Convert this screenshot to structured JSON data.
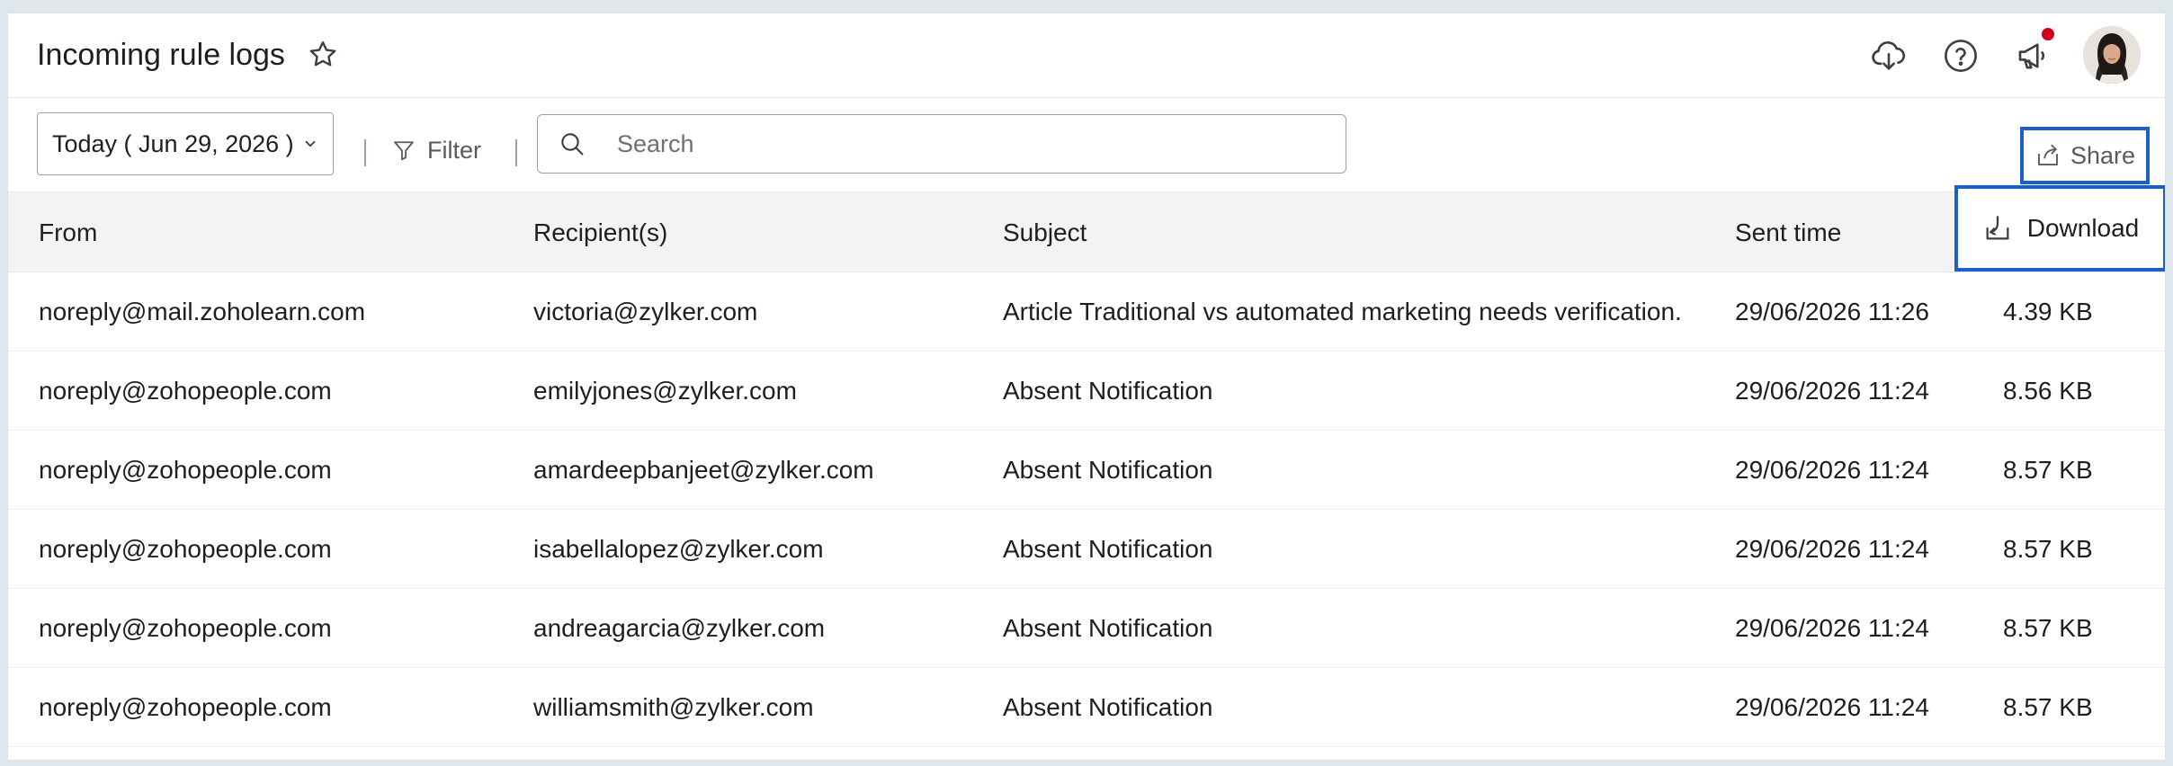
{
  "header": {
    "title": "Incoming rule logs"
  },
  "toolbar": {
    "date_label": "Today ( Jun 29, 2026 )",
    "filter_label": "Filter",
    "search_placeholder": "Search",
    "share_label": "Share"
  },
  "table": {
    "columns": {
      "from": "From",
      "recipients": "Recipient(s)",
      "subject": "Subject",
      "sent_time": "Sent time",
      "download": "Download"
    },
    "rows": [
      {
        "from": "noreply@mail.zoholearn.com",
        "recipients": "victoria@zylker.com",
        "subject": "Article Traditional vs automated marketing needs verification.",
        "sent_time": "29/06/2026 11:26",
        "size": "4.39 KB"
      },
      {
        "from": "noreply@zohopeople.com",
        "recipients": "emilyjones@zylker.com",
        "subject": "Absent Notification",
        "sent_time": "29/06/2026 11:24",
        "size": "8.56 KB"
      },
      {
        "from": "noreply@zohopeople.com",
        "recipients": "amardeepbanjeet@zylker.com",
        "subject": "Absent Notification",
        "sent_time": "29/06/2026 11:24",
        "size": "8.57 KB"
      },
      {
        "from": "noreply@zohopeople.com",
        "recipients": "isabellalopez@zylker.com",
        "subject": "Absent Notification",
        "sent_time": "29/06/2026 11:24",
        "size": "8.57 KB"
      },
      {
        "from": "noreply@zohopeople.com",
        "recipients": "andreagarcia@zylker.com",
        "subject": "Absent Notification",
        "sent_time": "29/06/2026 11:24",
        "size": "8.57 KB"
      },
      {
        "from": "noreply@zohopeople.com",
        "recipients": "williamsmith@zylker.com",
        "subject": "Absent Notification",
        "sent_time": "29/06/2026 11:24",
        "size": "8.57 KB"
      }
    ]
  },
  "icons": {
    "favorite": "star-icon",
    "download_app": "cloud-download-icon",
    "help": "help-icon",
    "announcements": "megaphone-icon",
    "filter": "filter-icon",
    "search": "search-icon",
    "share": "share-icon",
    "download": "download-icon"
  },
  "colors": {
    "highlight_border": "#1b5fc9",
    "notification_dot": "#d0021b",
    "header_row_bg": "#f1f3f5"
  }
}
